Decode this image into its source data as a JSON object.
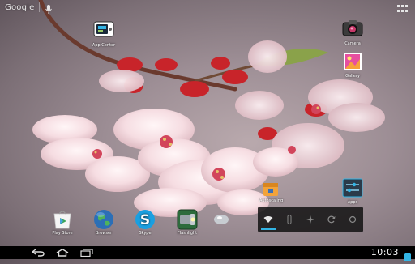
{
  "search": {
    "label": "Google"
  },
  "icons": {
    "app_center": "App Center",
    "camera": "Camera",
    "gallery": "Gallery",
    "apps_widget": "Apps",
    "play_store": "Play Store",
    "browser": "Browser",
    "skype": "Skype",
    "flashlight": "Flashlight",
    "unknown_app": "Autoscaling"
  },
  "status_bar": {
    "time": "10:03"
  },
  "colors": {
    "accent": "#33b5e5",
    "navbar": "#000000"
  }
}
